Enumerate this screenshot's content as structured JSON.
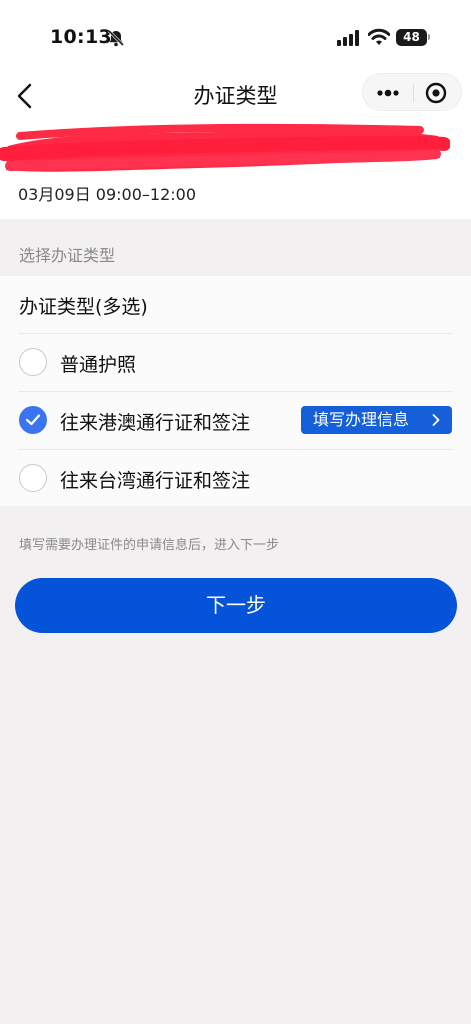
{
  "status_bar": {
    "time": "10:13",
    "battery": "48",
    "icons": [
      "bell-off-icon",
      "signal-icon",
      "wifi-icon",
      "battery-icon"
    ]
  },
  "nav": {
    "title": "办证类型",
    "back_icon": "chevron-left-icon",
    "capsule_icons": [
      "more-dots-icon",
      "target-icon"
    ]
  },
  "appointment": {
    "datetime": "03月09日 09:00–12:00"
  },
  "section": {
    "label": "选择办证类型"
  },
  "card": {
    "title": "办证类型(多选)",
    "options": [
      {
        "label": "普通护照",
        "checked": false
      },
      {
        "label": "往来港澳通行证和签注",
        "checked": true,
        "action": "填写办理信息"
      },
      {
        "label": "往来台湾通行证和签注",
        "checked": false
      }
    ]
  },
  "hint": "填写需要办理证件的申请信息后，进入下一步",
  "next_button": "下一步",
  "colors": {
    "primary": "#0553d8",
    "checked": "#3a74f0",
    "background": "#f2f0f0",
    "redaction": "#ff1e3c"
  }
}
